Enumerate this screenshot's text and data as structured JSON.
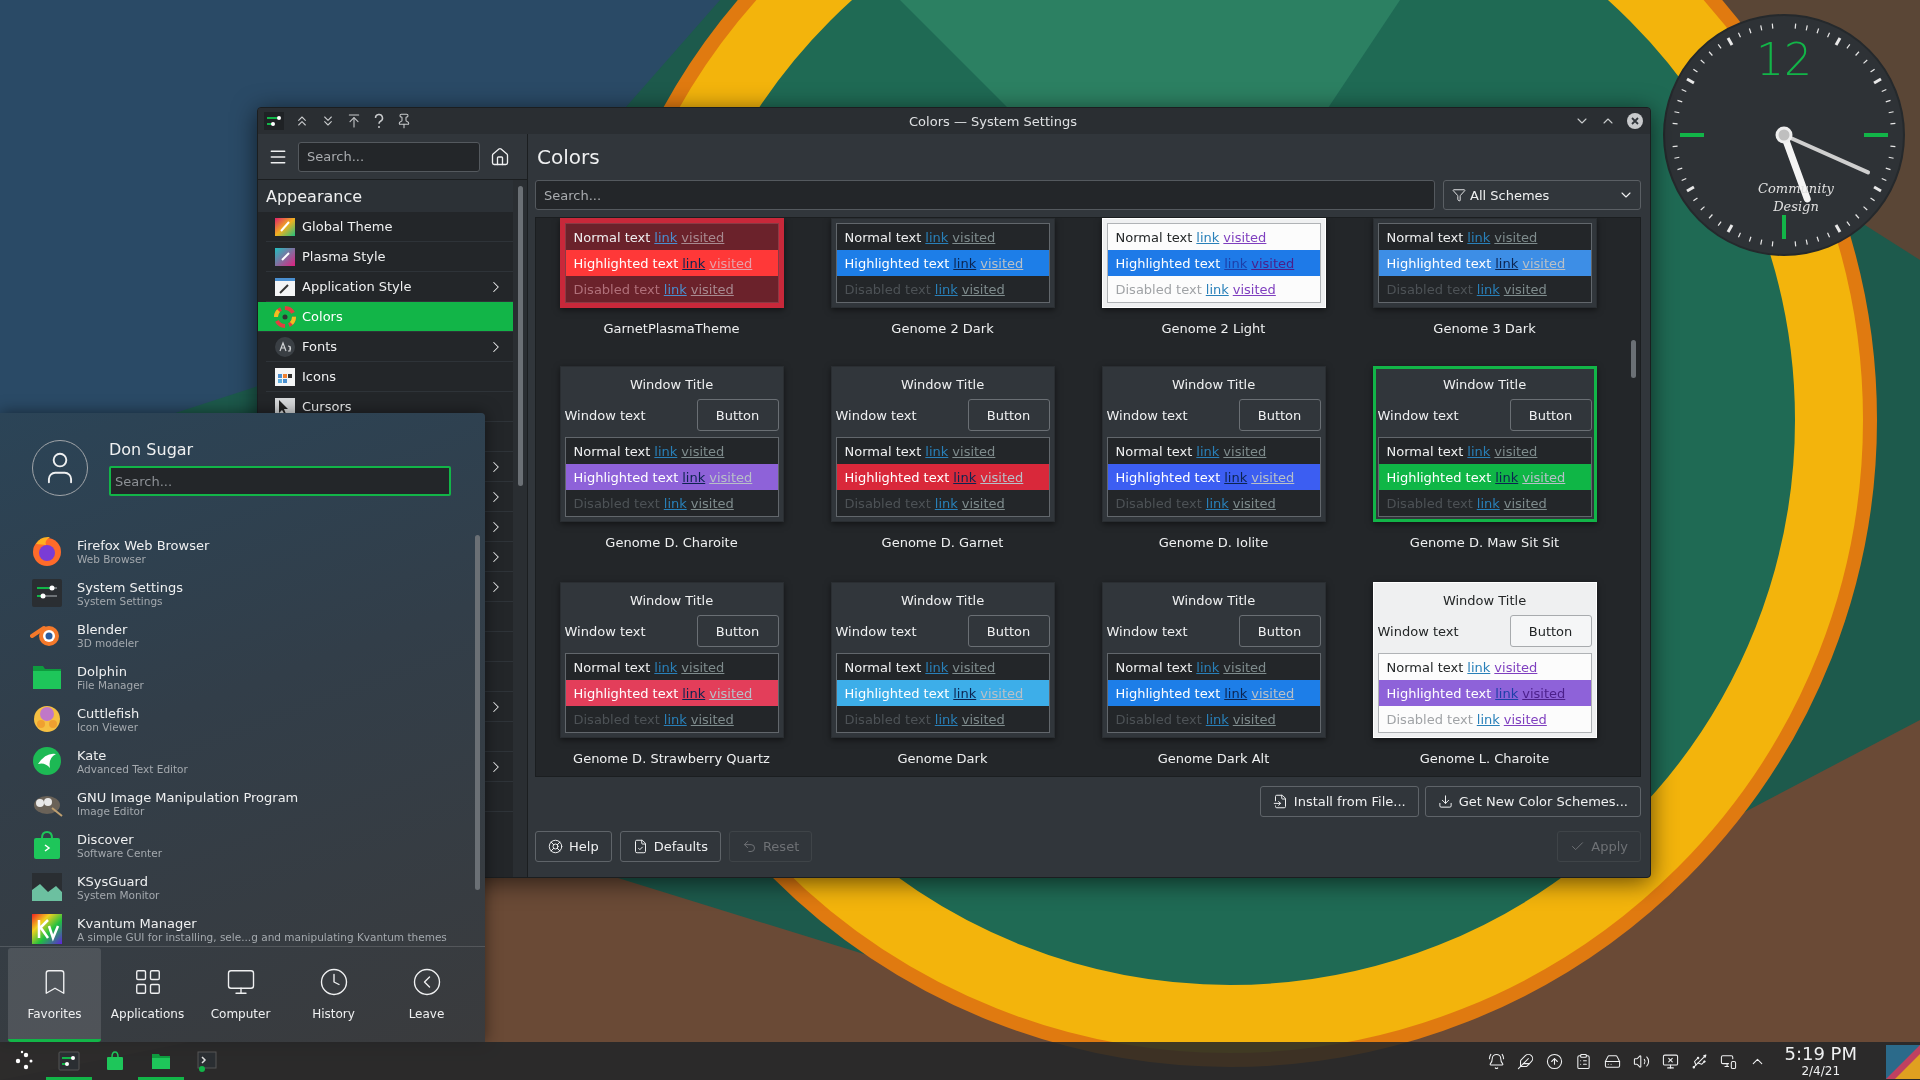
{
  "settings": {
    "title": "Colors — System Settings",
    "sidebar": {
      "search": {
        "placeholder": "Search..."
      },
      "section": "Appearance",
      "items": [
        {
          "label": "Global Theme",
          "selected": false,
          "has_children": false
        },
        {
          "label": "Plasma Style",
          "selected": false,
          "has_children": false
        },
        {
          "label": "Application Style",
          "selected": false,
          "has_children": true
        },
        {
          "label": "Colors",
          "selected": true,
          "has_children": false
        },
        {
          "label": "Fonts",
          "selected": false,
          "has_children": true
        },
        {
          "label": "Icons",
          "selected": false,
          "has_children": false
        },
        {
          "label": "Cursors",
          "selected": false,
          "has_children": false
        }
      ],
      "covered_rows": [
        {
          "kind": "header"
        },
        {
          "kind": "item",
          "has_children": true
        },
        {
          "kind": "item",
          "has_children": true
        },
        {
          "kind": "item",
          "has_children": true
        },
        {
          "kind": "item",
          "has_children": true
        },
        {
          "kind": "item",
          "has_children": true
        },
        {
          "kind": "header"
        },
        {
          "kind": "item"
        },
        {
          "kind": "item"
        },
        {
          "kind": "item",
          "has_children": true
        },
        {
          "kind": "item"
        },
        {
          "kind": "item",
          "has_children": true
        },
        {
          "kind": "item"
        }
      ]
    },
    "page_title": "Colors",
    "search": {
      "placeholder": "Search..."
    },
    "filter": "All Schemes",
    "schemes": [
      {
        "name": "GarnetPlasmaTheme",
        "kind": "garnet",
        "color": "#ff3838",
        "selected": false,
        "lines": [
          {
            "kind": "normal",
            "text": "Normal text",
            "link": "link",
            "visited": "visited"
          },
          {
            "kind": "highlighted",
            "text": "Highlighted text",
            "link": "link",
            "visited": "visited"
          },
          {
            "kind": "disabled",
            "text": "Disabled text",
            "link": "link",
            "visited": "visited"
          }
        ]
      },
      {
        "name": "Genome 2 Dark",
        "kind": "dark",
        "color": "#1d7ee8",
        "selected": false,
        "lines": [
          {
            "kind": "normal",
            "text": "Normal text",
            "link": "link",
            "visited": "visited"
          },
          {
            "kind": "highlighted",
            "text": "Highlighted text",
            "link": "link",
            "visited": "visited"
          },
          {
            "kind": "disabled",
            "text": "Disabled text",
            "link": "link",
            "visited": "visited"
          }
        ]
      },
      {
        "name": "Genome 2 Light",
        "kind": "light",
        "color": "#1e7ae8",
        "selected": false,
        "lines": [
          {
            "kind": "normal",
            "text": "Normal text",
            "link": "link",
            "visited": "visited"
          },
          {
            "kind": "highlighted",
            "text": "Highlighted text",
            "link": "link",
            "visited": "visited"
          },
          {
            "kind": "disabled",
            "text": "Disabled text",
            "link": "link",
            "visited": "visited"
          }
        ]
      },
      {
        "name": "Genome 3 Dark",
        "kind": "dark",
        "color": "#3d8ee6",
        "selected": false,
        "lines": [
          {
            "kind": "normal",
            "text": "Normal text",
            "link": "link",
            "visited": "visited"
          },
          {
            "kind": "highlighted",
            "text": "Highlighted text",
            "link": "link",
            "visited": "visited"
          },
          {
            "kind": "disabled",
            "text": "Disabled text",
            "link": "link",
            "visited": "visited"
          }
        ]
      },
      {
        "name": "Genome D. Charoite",
        "kind": "dark",
        "color": "#8e62d9",
        "selected": false,
        "window_title": "Window Title",
        "window_text": "Window text",
        "button": "Button",
        "lines": [
          {
            "kind": "normal",
            "text": "Normal text",
            "link": "link",
            "visited": "visited"
          },
          {
            "kind": "highlighted",
            "text": "Highlighted text",
            "link": "link",
            "visited": "visited"
          },
          {
            "kind": "disabled",
            "text": "Disabled text",
            "link": "link",
            "visited": "visited"
          }
        ]
      },
      {
        "name": "Genome D. Garnet",
        "kind": "dark",
        "color": "#d9283a",
        "selected": false,
        "window_title": "Window Title",
        "window_text": "Window text",
        "button": "Button",
        "lines": [
          {
            "kind": "normal",
            "text": "Normal text",
            "link": "link",
            "visited": "visited"
          },
          {
            "kind": "highlighted",
            "text": "Highlighted text",
            "link": "link",
            "visited": "visited"
          },
          {
            "kind": "disabled",
            "text": "Disabled text",
            "link": "link",
            "visited": "visited"
          }
        ]
      },
      {
        "name": "Genome D. Iolite",
        "kind": "dark",
        "color": "#3c5ef2",
        "selected": false,
        "window_title": "Window Title",
        "window_text": "Window text",
        "button": "Button",
        "lines": [
          {
            "kind": "normal",
            "text": "Normal text",
            "link": "link",
            "visited": "visited"
          },
          {
            "kind": "highlighted",
            "text": "Highlighted text",
            "link": "link",
            "visited": "visited"
          },
          {
            "kind": "disabled",
            "text": "Disabled text",
            "link": "link",
            "visited": "visited"
          }
        ]
      },
      {
        "name": "Genome D. Maw Sit Sit",
        "kind": "dark",
        "color": "#0fb646",
        "selected": true,
        "window_title": "Window Title",
        "window_text": "Window text",
        "button": "Button",
        "lines": [
          {
            "kind": "normal",
            "text": "Normal text",
            "link": "link",
            "visited": "visited"
          },
          {
            "kind": "highlighted",
            "text": "Highlighted text",
            "link": "link",
            "visited": "visited"
          },
          {
            "kind": "disabled",
            "text": "Disabled text",
            "link": "link",
            "visited": "visited"
          }
        ]
      },
      {
        "name": "Genome D. Strawberry Quartz",
        "kind": "dark",
        "color": "#e33e5a",
        "selected": false,
        "window_title": "Window Title",
        "window_text": "Window text",
        "button": "Button",
        "lines": [
          {
            "kind": "normal",
            "text": "Normal text",
            "link": "link",
            "visited": "visited"
          },
          {
            "kind": "highlighted",
            "text": "Highlighted text",
            "link": "link",
            "visited": "visited"
          },
          {
            "kind": "disabled",
            "text": "Disabled text",
            "link": "link",
            "visited": "visited"
          }
        ]
      },
      {
        "name": "Genome Dark",
        "kind": "dark",
        "color": "#3daee9",
        "selected": false,
        "window_title": "Window Title",
        "window_text": "Window text",
        "button": "Button",
        "lines": [
          {
            "kind": "normal",
            "text": "Normal text",
            "link": "link",
            "visited": "visited"
          },
          {
            "kind": "highlighted",
            "text": "Highlighted text",
            "link": "link",
            "visited": "visited"
          },
          {
            "kind": "disabled",
            "text": "Disabled text",
            "link": "link",
            "visited": "visited"
          }
        ]
      },
      {
        "name": "Genome Dark Alt",
        "kind": "dark",
        "color": "#1d7ee8",
        "selected": false,
        "window_title": "Window Title",
        "window_text": "Window text",
        "button": "Button",
        "lines": [
          {
            "kind": "normal",
            "text": "Normal text",
            "link": "link",
            "visited": "visited"
          },
          {
            "kind": "highlighted",
            "text": "Highlighted text",
            "link": "link",
            "visited": "visited"
          },
          {
            "kind": "disabled",
            "text": "Disabled text",
            "link": "link",
            "visited": "visited"
          }
        ]
      },
      {
        "name": "Genome L. Charoite",
        "kind": "light",
        "color": "#8e62d9",
        "selected": false,
        "window_title": "Window Title",
        "window_text": "Window text",
        "button": "Button",
        "lines": [
          {
            "kind": "normal",
            "text": "Normal text",
            "link": "link",
            "visited": "visited"
          },
          {
            "kind": "highlighted",
            "text": "Highlighted text",
            "link": "link",
            "visited": "visited"
          },
          {
            "kind": "disabled",
            "text": "Disabled text",
            "link": "link",
            "visited": "visited"
          }
        ]
      }
    ],
    "actions": [
      {
        "label": "Install from File...",
        "kind": "install"
      },
      {
        "label": "Get New Color Schemes...",
        "kind": "download"
      }
    ],
    "footer": [
      {
        "label": "Help",
        "kind": "help",
        "disabled": false
      },
      {
        "label": "Defaults",
        "kind": "defaults",
        "disabled": false
      },
      {
        "label": "Reset",
        "kind": "reset",
        "disabled": true
      },
      {
        "label": "Apply",
        "kind": "apply",
        "disabled": true
      }
    ]
  },
  "launcher": {
    "user": "Don Sugar",
    "search": {
      "placeholder": "Search..."
    },
    "apps": [
      {
        "name": "Firefox Web Browser",
        "subtitle": "Web Browser"
      },
      {
        "name": "System Settings",
        "subtitle": "System Settings"
      },
      {
        "name": "Blender",
        "subtitle": "3D modeler"
      },
      {
        "name": "Dolphin",
        "subtitle": "File Manager"
      },
      {
        "name": "Cuttlefish",
        "subtitle": "Icon Viewer"
      },
      {
        "name": "Kate",
        "subtitle": "Advanced Text Editor"
      },
      {
        "name": "GNU Image Manipulation Program",
        "subtitle": "Image Editor"
      },
      {
        "name": "Discover",
        "subtitle": "Software Center"
      },
      {
        "name": "KSysGuard",
        "subtitle": "System Monitor"
      },
      {
        "name": "Kvantum Manager",
        "subtitle": "A simple GUI for installing, sele...g and manipulating Kvantum themes"
      }
    ],
    "tabs": [
      {
        "label": "Favorites",
        "kind": "favorites",
        "selected": true
      },
      {
        "label": "Applications",
        "kind": "applications",
        "selected": false
      },
      {
        "label": "Computer",
        "kind": "computer",
        "selected": false
      },
      {
        "label": "History",
        "kind": "history",
        "selected": false
      },
      {
        "label": "Leave",
        "kind": "leave",
        "selected": false
      }
    ]
  },
  "taskbar": {
    "tasks": [
      {
        "running": true
      },
      {
        "running": false
      },
      {
        "running": true
      },
      {
        "running": false
      }
    ],
    "time": "5:19 PM",
    "date": "2/4/21"
  },
  "clock": {
    "numeral": "12",
    "brand": [
      "Community",
      "Design"
    ]
  }
}
